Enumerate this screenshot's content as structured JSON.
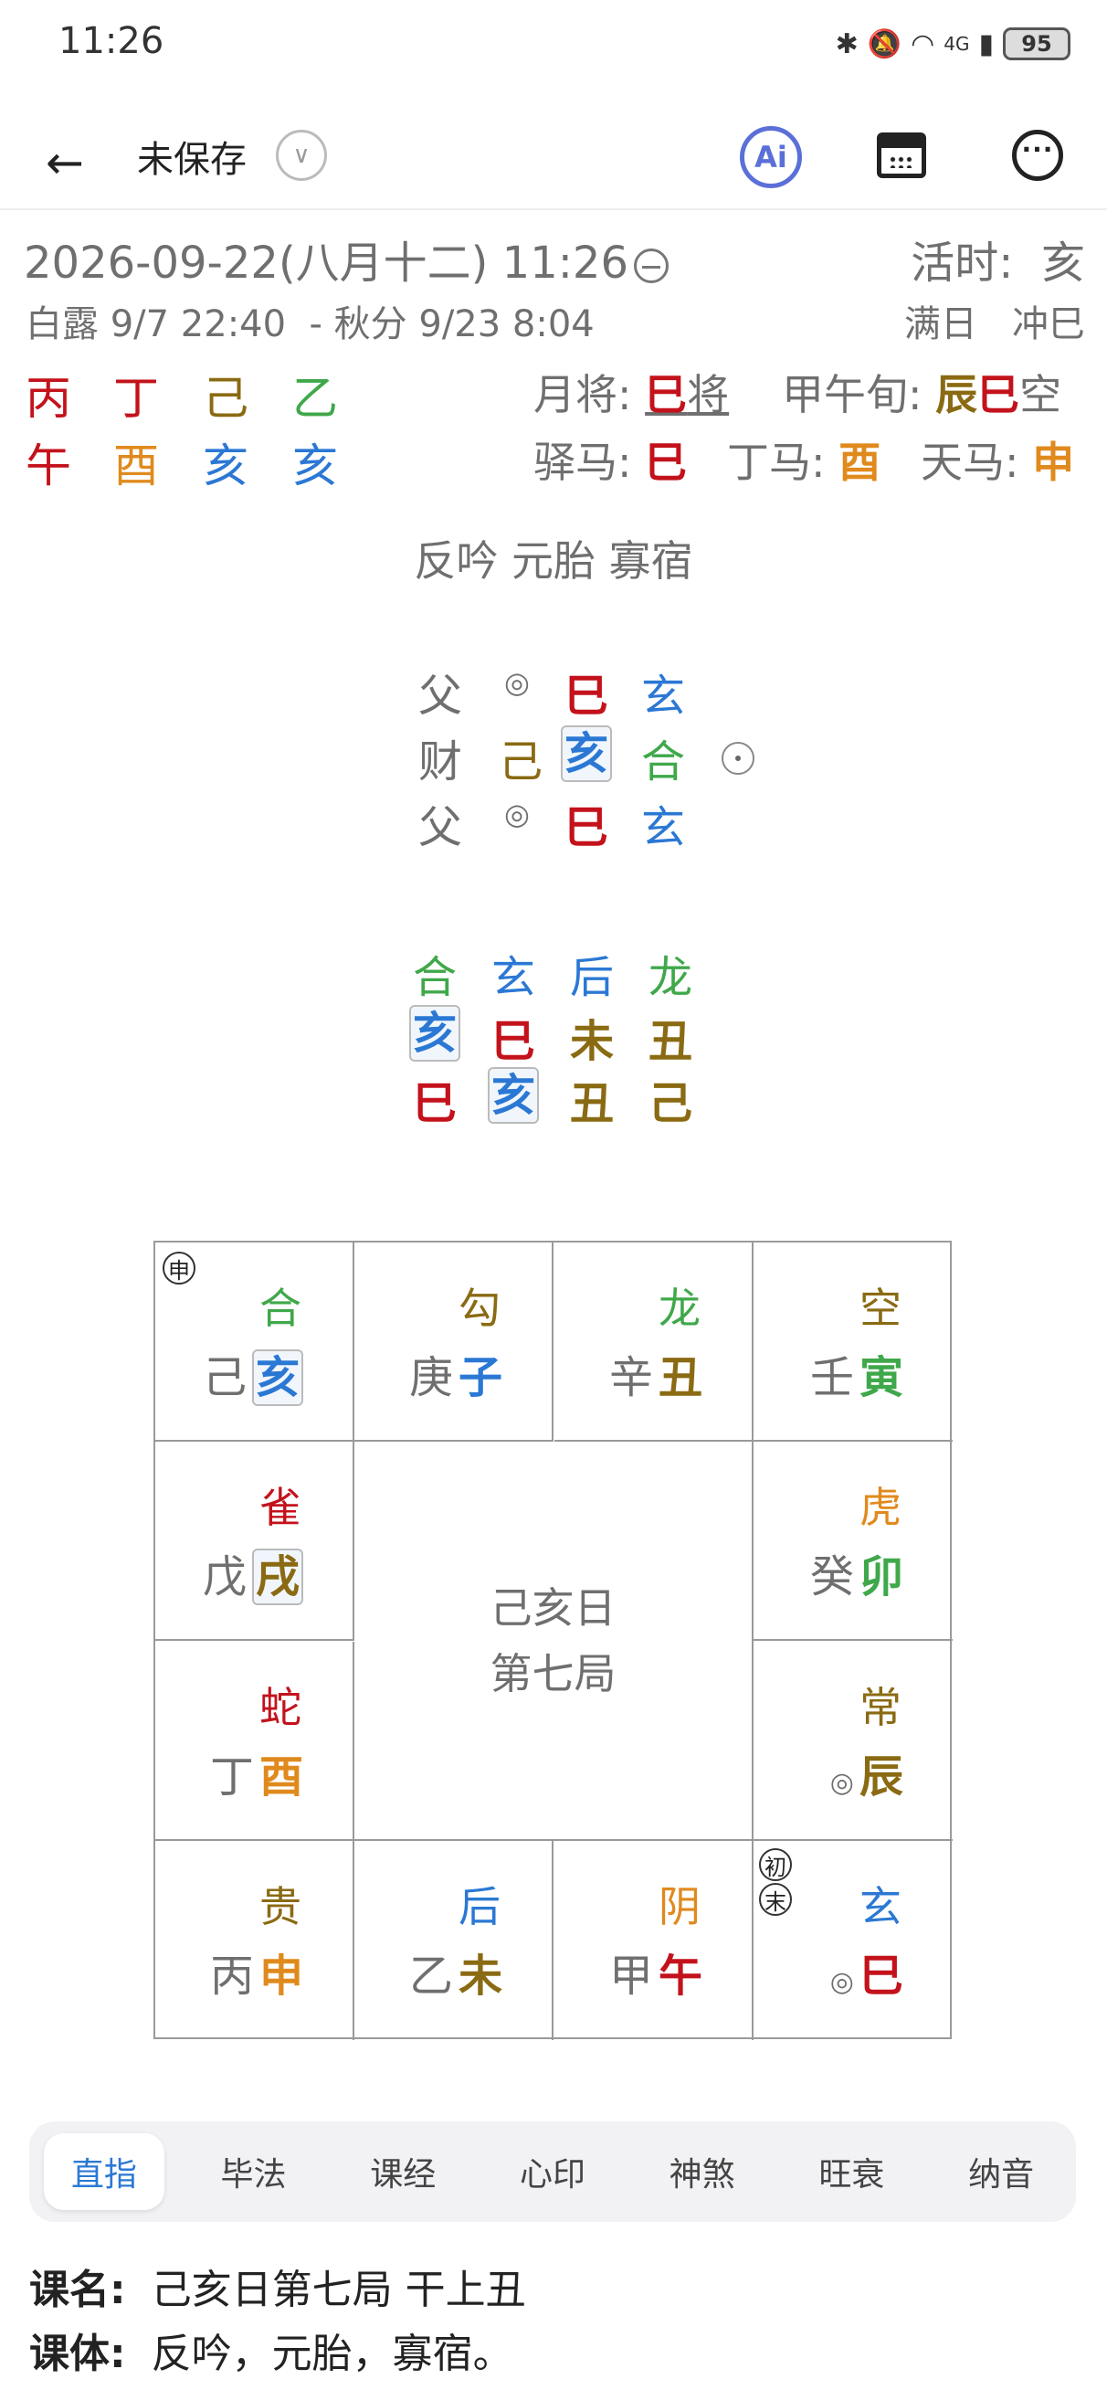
{
  "status": {
    "time": "11:26",
    "battery": "95",
    "network": "4G"
  },
  "toolbar": {
    "title": "未保存",
    "ai_label": "Ai"
  },
  "header": {
    "date": "2026-09-22(八月十二) 11:26",
    "active_hour_label": "活时:",
    "active_hour_value": "亥",
    "term_start": "白露 9/7 22:40",
    "term_separator": "-",
    "term_end": "秋分 9/23 8:04",
    "day_status": "满日",
    "day_clash": "冲巳"
  },
  "pillars": {
    "stems": [
      {
        "text": "丙",
        "color": "red"
      },
      {
        "text": "丁",
        "color": "red"
      },
      {
        "text": "己",
        "color": "olive"
      },
      {
        "text": "乙",
        "color": "green"
      }
    ],
    "branches": [
      {
        "text": "午",
        "color": "red"
      },
      {
        "text": "酉",
        "color": "orange"
      },
      {
        "text": "亥",
        "color": "blue"
      },
      {
        "text": "亥",
        "color": "blue"
      }
    ]
  },
  "side": {
    "month_general_label": "月将:",
    "month_general_branch": "巳",
    "month_general_suffix": "将",
    "xun_label": "甲午旬:",
    "xun_void_1": "辰",
    "xun_void_2": "巳",
    "xun_suffix": "空",
    "post_horse_label": "驿马:",
    "post_horse_value": "巳",
    "ding_horse_label": "丁马:",
    "ding_horse_value": "酉",
    "sky_horse_label": "天马:",
    "sky_horse_value": "申"
  },
  "special": "反吟 元胎 寡宿",
  "transmissions": [
    {
      "relation": "父",
      "stem": "◎",
      "branch": "巳",
      "god": "玄"
    },
    {
      "relation": "财",
      "stem": "己",
      "branch": "亥",
      "god": "合"
    },
    {
      "relation": "父",
      "stem": "◎",
      "branch": "巳",
      "god": "玄"
    }
  ],
  "lessons": {
    "gods": [
      "合",
      "玄",
      "后",
      "龙"
    ],
    "upper": [
      "亥",
      "巳",
      "未",
      "丑"
    ],
    "lower": [
      "巳",
      "亥",
      "丑",
      "己"
    ]
  },
  "plate": {
    "center_line1": "己亥日",
    "center_line2": "第七局",
    "badge_shen": "申",
    "badge_chu": "初",
    "badge_mo": "末",
    "cells": {
      "hai": {
        "god": "合",
        "stem": "己",
        "branch": "亥"
      },
      "zi": {
        "god": "勾",
        "stem": "庚",
        "branch": "子"
      },
      "chou": {
        "god": "龙",
        "stem": "辛",
        "branch": "丑"
      },
      "yin": {
        "god": "空",
        "stem": "壬",
        "branch": "寅"
      },
      "xu": {
        "god": "雀",
        "stem": "戊",
        "branch": "戌"
      },
      "mao": {
        "god": "虎",
        "stem": "癸",
        "branch": "卯"
      },
      "you": {
        "god": "蛇",
        "stem": "丁",
        "branch": "酉"
      },
      "chen": {
        "god": "常",
        "stem": "◎",
        "branch": "辰"
      },
      "shen": {
        "god": "贵",
        "stem": "丙",
        "branch": "申"
      },
      "wei": {
        "god": "后",
        "stem": "乙",
        "branch": "未"
      },
      "wu": {
        "god": "阴",
        "stem": "甲",
        "branch": "午"
      },
      "si": {
        "god": "玄",
        "stem": "◎",
        "branch": "巳"
      }
    }
  },
  "tabs": [
    "直指",
    "毕法",
    "课经",
    "心印",
    "神煞",
    "旺衰",
    "纳音"
  ],
  "bottom": {
    "name_label": "课名:",
    "name_value": "己亥日第七局 干上丑",
    "type_label": "课体:",
    "type_value": "反吟，元胎，寡宿。"
  }
}
